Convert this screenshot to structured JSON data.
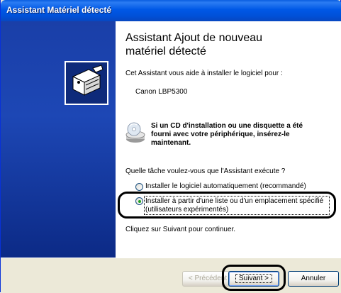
{
  "window": {
    "title": "Assistant Matériel détecté"
  },
  "wizard": {
    "heading_line1": "Assistant Ajout de nouveau",
    "heading_line2": "matériel détecté",
    "intro": "Cet Assistant vous aide à installer le logiciel pour :",
    "device": "Canon LBP5300",
    "cd_line1": "Si un CD d'installation ou une disquette a été",
    "cd_line2": "fourni avec votre périphérique, insérez-le",
    "cd_line3": "maintenant.",
    "question": "Quelle tâche voulez-vous que l'Assistant exécute ?",
    "options": [
      {
        "label": "Installer le logiciel automatiquement (recommandé)",
        "selected": false
      },
      {
        "label_line1": "Installer à partir d'une liste ou d'un emplacement spécifié",
        "label_line2": "(utilisateurs expérimentés)",
        "selected": true
      }
    ],
    "continue_hint": "Cliquez sur Suivant pour continuer."
  },
  "buttons": {
    "back": "< Précédent",
    "next": "Suivant >",
    "cancel": "Annuler"
  },
  "colors": {
    "titlebar": "#0054e3",
    "sidebar": "#1d47b5",
    "radio_dot": "#21a121"
  }
}
